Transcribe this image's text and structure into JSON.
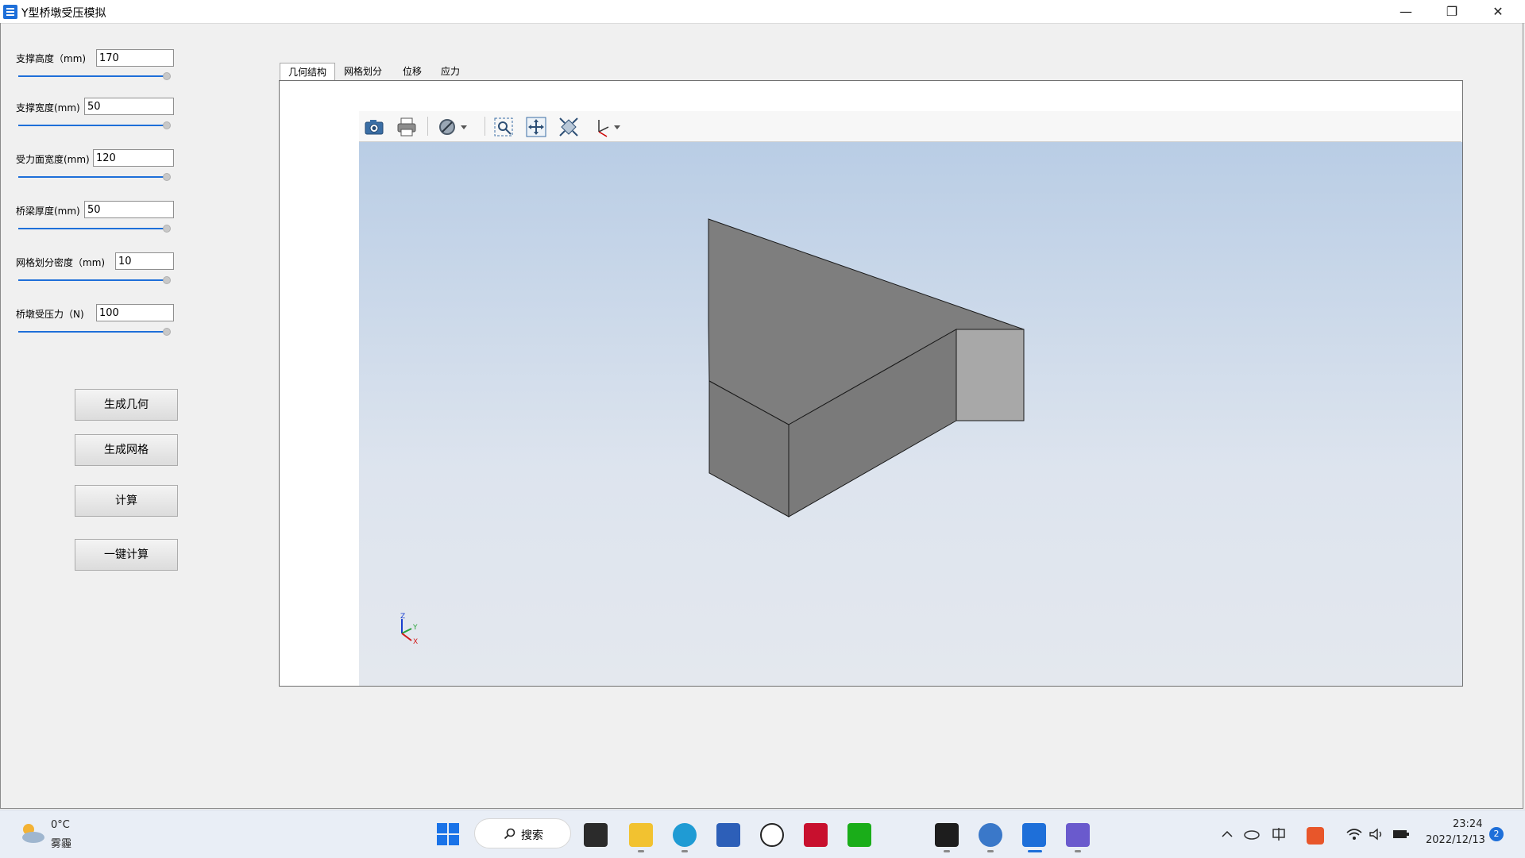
{
  "window": {
    "title": "Y型桥墩受压模拟",
    "minimize_glyph": "—",
    "maximize_glyph": "❐",
    "close_glyph": "✕"
  },
  "params": [
    {
      "label": "支撑高度（mm)",
      "value": "170"
    },
    {
      "label": "支撑宽度(mm)",
      "value": "50"
    },
    {
      "label": "受力面宽度(mm)",
      "value": "120"
    },
    {
      "label": "桥梁厚度(mm)",
      "value": "50"
    },
    {
      "label": "网格划分密度（mm)",
      "value": "10"
    },
    {
      "label": "桥墩受压力（N)",
      "value": "100"
    }
  ],
  "buttons": {
    "generate_geometry": "生成几何",
    "generate_mesh": "生成网格",
    "compute": "计算",
    "one_click_compute": "一键计算"
  },
  "tabs": [
    "几何结构",
    "网格划分",
    "位移",
    "应力"
  ],
  "active_tab": "几何结构",
  "toolbar_icons": [
    "camera-icon",
    "print-icon",
    "display-mode-icon",
    "zoom-box-icon",
    "pan-icon",
    "fit-all-icon",
    "axes-view-icon"
  ],
  "axes": {
    "z": "Z",
    "y": "Y",
    "x": "X"
  },
  "colors": {
    "shape_top": "#7e7e7e",
    "shape_front": "#7a7a7a",
    "shape_end": "#a8a8a8",
    "accent": "#1e6fd9"
  },
  "taskbar": {
    "weather_temp": "0°C",
    "weather_desc": "雾霾",
    "search_label": "搜索",
    "time": "23:24",
    "date": "2022/12/13",
    "notification_count": "2"
  }
}
